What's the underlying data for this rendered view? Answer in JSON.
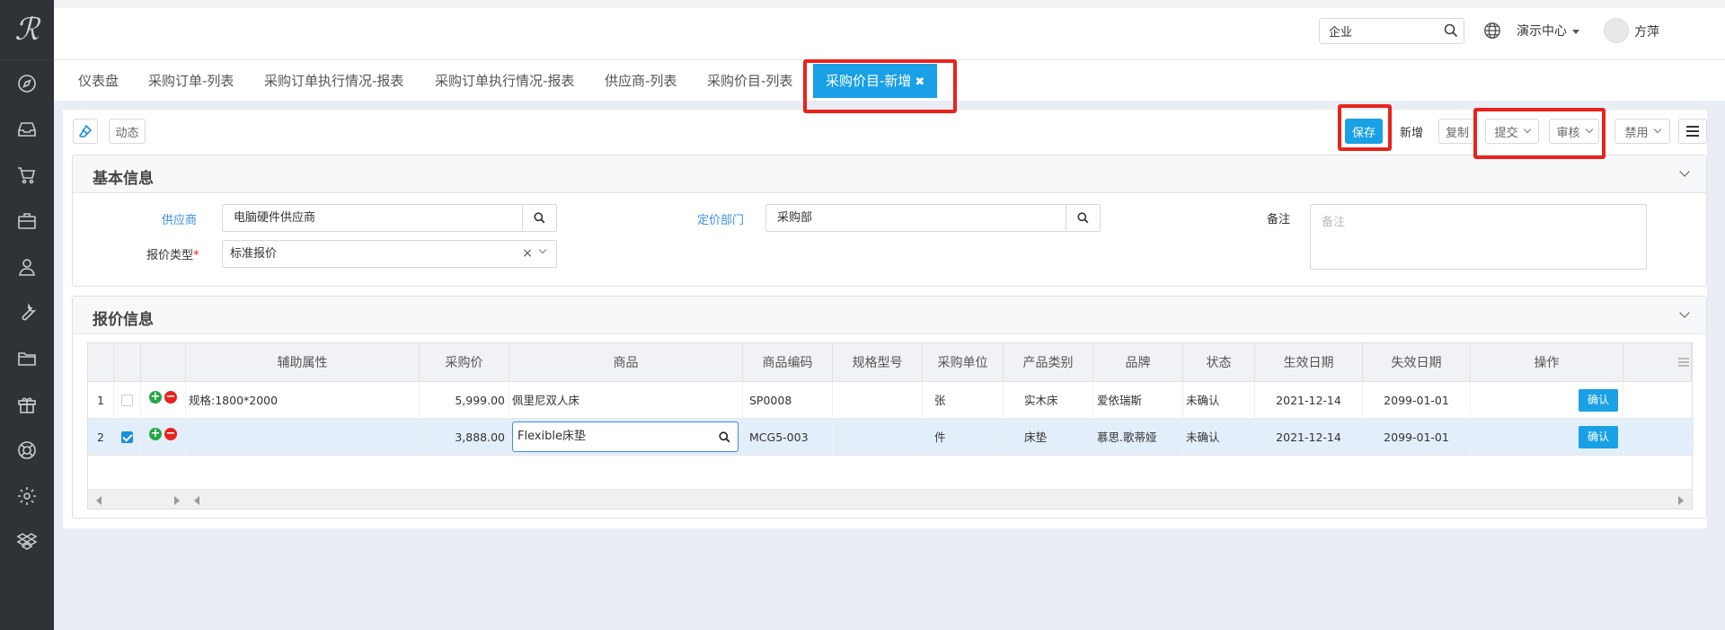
{
  "header": {
    "logo_text": "ℛ",
    "search_value": "企业",
    "center_menu": "演示中心",
    "username": "方萍",
    "help_label": "?"
  },
  "sidebar": {
    "icons": [
      "compass-icon",
      "inbox-icon",
      "cart-icon",
      "briefcase-icon",
      "user-icon",
      "wrench-icon",
      "folder-icon",
      "gift-icon",
      "lifebuoy-icon",
      "gear-icon",
      "dropbox-icon"
    ]
  },
  "tabs": [
    {
      "label": "仪表盘"
    },
    {
      "label": "采购订单-列表"
    },
    {
      "label": "采购订单执行情况-报表"
    },
    {
      "label": "采购订单执行情况-报表"
    },
    {
      "label": "供应商-列表"
    },
    {
      "label": "采购价目-列表"
    },
    {
      "label": "采购价目-新增",
      "close": "✖"
    }
  ],
  "toolbar": {
    "dynamic_label": "动态",
    "save_label": "保存",
    "new_label": "新增",
    "copy_label": "复制",
    "submit_label": "提交",
    "audit_label": "审核",
    "disable_label": "禁用"
  },
  "basic_info": {
    "title": "基本信息",
    "supplier_label": "供应商",
    "supplier_value": "电脑硬件供应商",
    "dept_label": "定价部门",
    "dept_value": "采购部",
    "remark_label": "备注",
    "remark_placeholder": "备注",
    "quote_type_label": "报价类型",
    "required_mark": "*",
    "quote_type_value": "标准报价",
    "clear_mark": "×"
  },
  "quote_info": {
    "title": "报价信息",
    "columns": [
      "辅助属性",
      "采购价",
      "商品",
      "商品编码",
      "规格型号",
      "采购单位",
      "产品类别",
      "品牌",
      "状态",
      "生效日期",
      "失效日期",
      "操作"
    ],
    "rows": [
      {
        "index": "1",
        "aux": "规格:1800*2000",
        "price": "5,999.00",
        "product": "佩里尼双人床",
        "code": "SP0008",
        "spec": "",
        "unit": "张",
        "category": "实木床",
        "brand": "爱依瑞斯",
        "status": "未确认",
        "start": "2021-12-14",
        "end": "2099-01-01",
        "action": "确认",
        "checked": false
      },
      {
        "index": "2",
        "aux": "",
        "price": "3,888.00",
        "product": "Flexible床垫",
        "code": "MCG5-003",
        "spec": "",
        "unit": "件",
        "category": "床垫",
        "brand": "慕思.歌蒂娅",
        "status": "未确认",
        "start": "2021-12-14",
        "end": "2099-01-01",
        "action": "确认",
        "checked": true
      }
    ]
  },
  "colors": {
    "accent": "#1aa0e6",
    "annotation": "#e8231c",
    "sidebar_bg": "#2f3237"
  }
}
